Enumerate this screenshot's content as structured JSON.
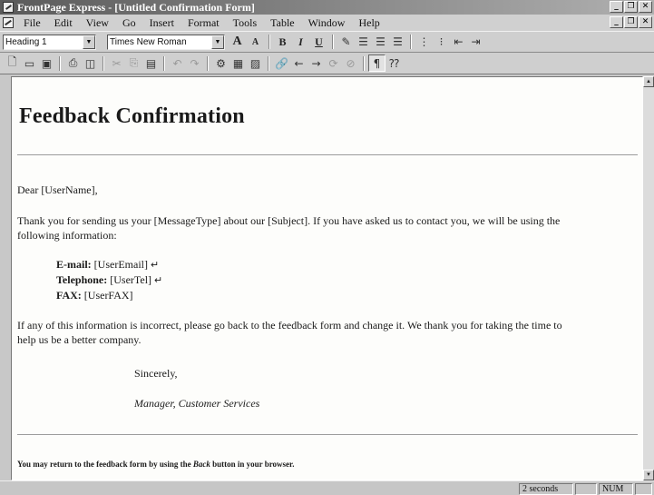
{
  "window": {
    "title": "FrontPage Express - [Untitled Confirmation Form]",
    "controls": [
      "_",
      "❐",
      "✕"
    ],
    "doc_controls": [
      "_",
      "❐",
      "✕"
    ]
  },
  "menubar": {
    "items": [
      "File",
      "Edit",
      "View",
      "Go",
      "Insert",
      "Format",
      "Tools",
      "Table",
      "Window",
      "Help"
    ]
  },
  "format_toolbar": {
    "style_value": "Heading 1",
    "font_value": "Times New Roman",
    "grow_font": "A",
    "shrink_font": "A",
    "bold": "B",
    "italic": "I",
    "underline": "U"
  },
  "document": {
    "heading": "Feedback Confirmation",
    "greeting": "Dear [UserName],",
    "thanks_line1": "Thank you for sending us your [MessageType] about our [Subject]. If you have asked us to contact you, we will be using the",
    "thanks_line2": "following information:",
    "contact": [
      {
        "label": "E-mail:",
        "value": "[UserEmail]",
        "break": "↵"
      },
      {
        "label": "Telephone:",
        "value": "[UserTel]",
        "break": "↵"
      },
      {
        "label": "FAX:",
        "value": "[UserFAX]",
        "break": ""
      }
    ],
    "incorrect_line1": "If any of this information is incorrect, please go back to the feedback form and change it. We thank you for taking the time to",
    "incorrect_line2": "help us be a better company.",
    "closing": "Sincerely,",
    "signature": "Manager, Customer Services",
    "footnote_pre": "You may return to the feedback form by using the ",
    "footnote_em": "Back",
    "footnote_post": " button in your browser."
  },
  "statusbar": {
    "time": "2 seconds",
    "num": "NUM"
  }
}
